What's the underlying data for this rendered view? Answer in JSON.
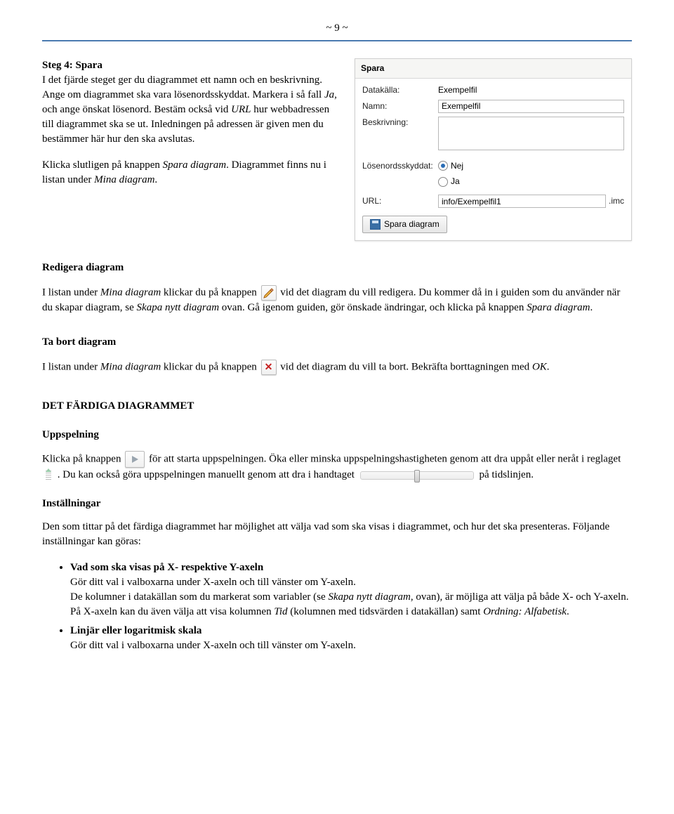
{
  "page_number": "~ 9 ~",
  "step4": {
    "title": "Steg 4: Spara",
    "p1a": "I det fjärde steget ger du diagrammet ett namn och en beskrivning. Ange om diagrammet ska vara lösenordsskyddat. Markera i så fall ",
    "p1b": "Ja",
    "p1c": ", och ange önskat lösenord. Bestäm också vid ",
    "p1d": "URL",
    "p1e": " hur webbadressen till diagrammet ska se ut. Inledningen på adressen är given men du bestämmer här hur den ska avslutas.",
    "p2a": "Klicka slutligen på knappen ",
    "p2b": "Spara diagram",
    "p2c": ". Diagrammet finns nu i listan under ",
    "p2d": "Mina diagram",
    "p2e": "."
  },
  "panel": {
    "title": "Spara",
    "datakalla_label": "Datakälla:",
    "datakalla_value": "Exempelfil",
    "namn_label": "Namn:",
    "namn_value": "Exempelfil",
    "beskrivning_label": "Beskrivning:",
    "losen_label": "Lösenordsskyddat:",
    "radio_nej": "Nej",
    "radio_ja": "Ja",
    "url_label": "URL:",
    "url_value": "info/Exempelfil1",
    "url_suffix": ".imc",
    "save_btn": "Spara diagram"
  },
  "redigera": {
    "title": "Redigera diagram",
    "a": "I listan under ",
    "b": "Mina diagram",
    "c": " klickar du på knappen ",
    "d": " vid det diagram du vill redigera. Du kommer då in i guiden som du använder när du skapar diagram, se ",
    "e": "Skapa nytt diagram",
    "f": " ovan. Gå igenom guiden, gör önskade ändringar, och klicka på knappen ",
    "g": "Spara diagram",
    "h": "."
  },
  "tabort": {
    "title": "Ta bort diagram",
    "a": "I listan under ",
    "b": "Mina diagram",
    "c": " klickar du på knappen ",
    "d": " vid det diagram du vill ta bort. Bekräfta borttagningen med ",
    "e": "OK",
    "f": "."
  },
  "fardiga": {
    "title": "DET FÄRDIGA DIAGRAMMET",
    "uppspelning_title": "Uppspelning",
    "u1": "Klicka på knappen ",
    "u2": " för att starta uppspelningen. Öka eller minska uppspelningshastigheten genom att dra uppåt eller neråt i reglaget ",
    "u3": ". Du kan också göra uppspelningen manuellt genom att dra i handtaget ",
    "u4": " på tidslinjen.",
    "installningar_title": "Inställningar",
    "inst_intro": "Den som tittar på det färdiga diagrammet har möjlighet att välja vad som ska visas i diagrammet, och hur det ska presenteras. Följande inställningar kan göras:",
    "li1_bold": "Vad som ska visas på X- respektive Y-axeln",
    "li1_a": "Gör ditt val i valboxarna under X-axeln och till vänster om Y-axeln.",
    "li1_b1": "De kolumner i datakällan som du markerat som variabler (se ",
    "li1_b2": "Skapa nytt diagram",
    "li1_b3": ", ovan), är möjliga att välja på både X- och Y-axeln.",
    "li1_c1": "På X-axeln kan du även välja att visa kolumnen ",
    "li1_c2": "Tid",
    "li1_c3": " (kolumnen med tidsvärden i datakällan) samt ",
    "li1_c4": "Ordning: Alfabetisk",
    "li1_c5": ".",
    "li2_bold": "Linjär eller logaritmisk skala",
    "li2_a": "Gör ditt val i valboxarna under X-axeln och till vänster om Y-axeln."
  }
}
